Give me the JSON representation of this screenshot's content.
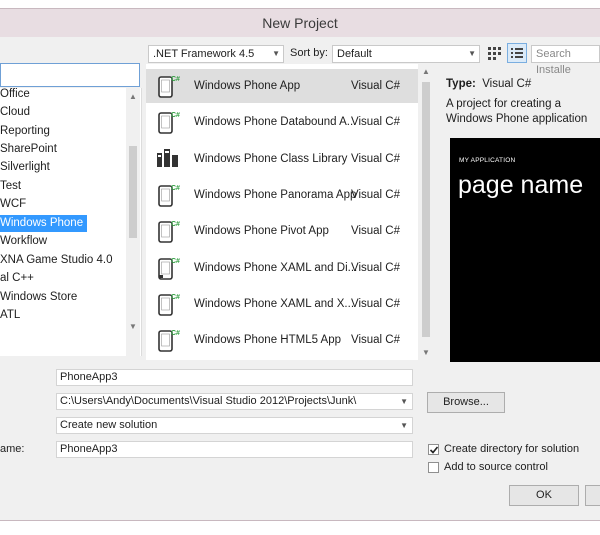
{
  "window": {
    "title": "New Project"
  },
  "toolbar": {
    "framework": ".NET Framework 4.5",
    "sort_label": "Sort by:",
    "sort_value": "Default",
    "search_placeholder": "Search Installe"
  },
  "tree": {
    "items": [
      {
        "label": "Office"
      },
      {
        "label": "Cloud"
      },
      {
        "label": "Reporting"
      },
      {
        "label": "SharePoint"
      },
      {
        "label": "Silverlight"
      },
      {
        "label": "Test"
      },
      {
        "label": "WCF"
      },
      {
        "label": "Windows Phone",
        "selected": true
      },
      {
        "label": "Workflow"
      },
      {
        "label": "XNA Game Studio 4.0"
      },
      {
        "label": "al C++"
      },
      {
        "label": "Windows Store"
      },
      {
        "label": "ATL"
      }
    ]
  },
  "templates": [
    {
      "name": "Windows Phone App",
      "lang": "Visual C#",
      "icon": "phone-app-icon",
      "selected": true
    },
    {
      "name": "Windows Phone Databound A...",
      "lang": "Visual C#",
      "icon": "phone-databound-icon"
    },
    {
      "name": "Windows Phone Class Library",
      "lang": "Visual C#",
      "icon": "class-library-icon"
    },
    {
      "name": "Windows Phone Panorama App",
      "lang": "Visual C#",
      "icon": "phone-panorama-icon"
    },
    {
      "name": "Windows Phone Pivot App",
      "lang": "Visual C#",
      "icon": "phone-pivot-icon"
    },
    {
      "name": "Windows Phone XAML and Di...",
      "lang": "Visual C#",
      "icon": "phone-xaml-direct3d-icon"
    },
    {
      "name": "Windows Phone XAML and X...",
      "lang": "Visual C#",
      "icon": "phone-xaml-xna-icon"
    },
    {
      "name": "Windows Phone HTML5 App",
      "lang": "Visual C#",
      "icon": "phone-html5-icon"
    }
  ],
  "info": {
    "type_label": "Type:",
    "type_value": "Visual C#",
    "description": "A project for creating a Windows Phone application",
    "preview_app_title": "MY APPLICATION",
    "preview_page_title": "page name"
  },
  "form": {
    "name_value": "PhoneApp3",
    "location_value": "C:\\Users\\Andy\\Documents\\Visual Studio 2012\\Projects\\Junk\\",
    "solution_value": "Create new solution",
    "solution_name_label_pre": "ame:",
    "solution_name_value": "PhoneApp3",
    "browse_label": "Browse...",
    "create_dir_label": "Create directory for solution",
    "create_dir_checked": true,
    "source_control_label": "Add to source control",
    "source_control_checked": false,
    "ok_label": "OK"
  },
  "colors": {
    "selection": "#3399ff",
    "title_bar": "#e8dde2",
    "icon_green": "#2e9e3e"
  }
}
